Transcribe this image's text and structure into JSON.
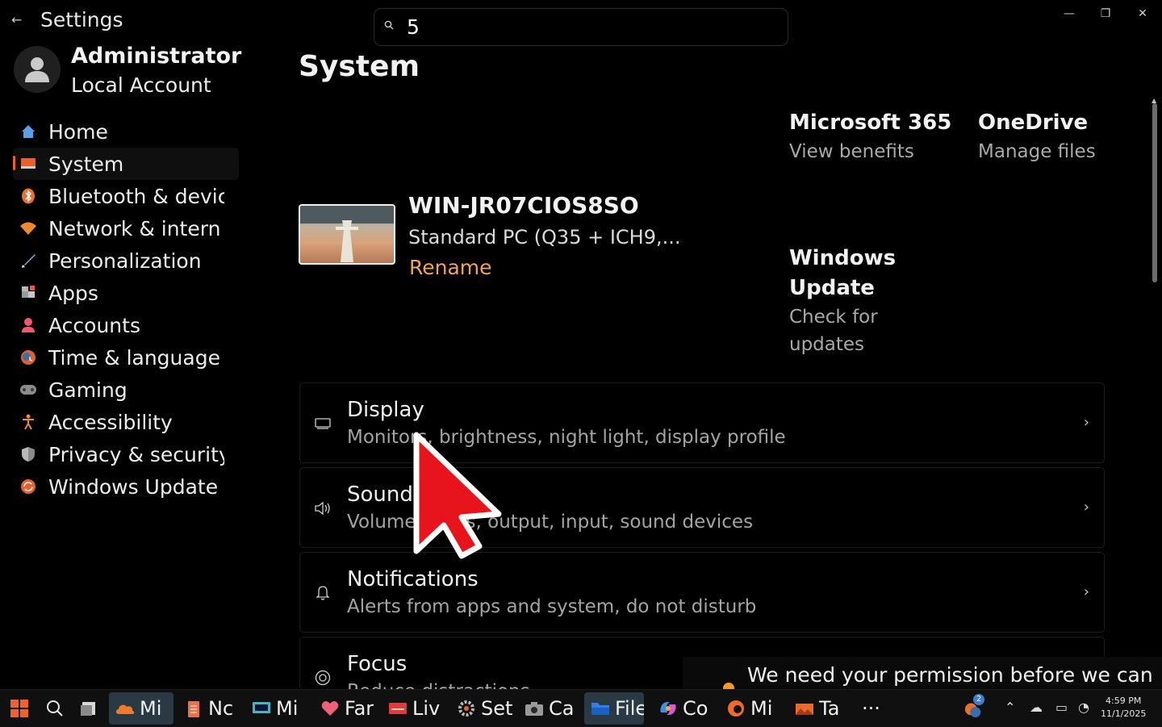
{
  "window": {
    "title": "Settings",
    "back_icon": "back-arrow-icon",
    "minimize_glyph": "—",
    "maximize_glyph": "❐",
    "close_glyph": "✕"
  },
  "search": {
    "value": "5",
    "icon": "search-icon"
  },
  "profile": {
    "name": "Administrator",
    "account_type": "Local Account"
  },
  "sidebar": {
    "items": [
      {
        "label": "Home",
        "icon": "home-icon"
      },
      {
        "label": "System",
        "icon": "system-icon",
        "selected": true
      },
      {
        "label": "Bluetooth & devic",
        "icon": "bluetooth-icon"
      },
      {
        "label": "Network & intern",
        "icon": "network-icon"
      },
      {
        "label": "Personalization",
        "icon": "brush-icon"
      },
      {
        "label": "Apps",
        "icon": "apps-icon"
      },
      {
        "label": "Accounts",
        "icon": "accounts-icon"
      },
      {
        "label": "Time & language",
        "icon": "time-language-icon"
      },
      {
        "label": "Gaming",
        "icon": "gaming-icon"
      },
      {
        "label": "Accessibility",
        "icon": "accessibility-icon"
      },
      {
        "label": "Privacy & security",
        "icon": "shield-icon"
      },
      {
        "label": "Windows Update",
        "icon": "windows-update-icon"
      }
    ]
  },
  "main": {
    "title": "System",
    "device": {
      "name": "WIN-JR07CIOS8SO",
      "model": "Standard PC (Q35 + ICH9,...",
      "rename_label": "Rename"
    },
    "promos": [
      {
        "title": "Microsoft 365",
        "subtitle": "View benefits"
      },
      {
        "title": "OneDrive",
        "subtitle": "Manage files"
      },
      {
        "title_line1": "Windows",
        "title_line2": "Update",
        "subtitle_line1": "Check for",
        "subtitle_line2": "updates"
      }
    ],
    "cards": [
      {
        "title": "Display",
        "subtitle": "Monitors, brightness, night light, display profile",
        "icon": "display-icon"
      },
      {
        "title": "Sound",
        "subtitle": "Volume levels, output, input, sound devices",
        "icon": "speaker-icon"
      },
      {
        "title": "Notifications",
        "subtitle": "Alerts from apps and system, do not disturb",
        "icon": "bell-icon"
      },
      {
        "title": "Focus",
        "subtitle": "Reduce distractions",
        "icon": "focus-icon"
      }
    ]
  },
  "toast": {
    "text": "We need your permission before we can"
  },
  "taskbar": {
    "apps": [
      {
        "label": "Mi",
        "icon": "onedrive-icon",
        "active": true
      },
      {
        "label": "Nc",
        "icon": "notepad-icon"
      },
      {
        "label": "Mi",
        "icon": "media-icon"
      },
      {
        "label": "Far",
        "icon": "heart-icon"
      },
      {
        "label": "Liv",
        "icon": "live-icon"
      },
      {
        "label": "Set",
        "icon": "settings-gear-icon"
      },
      {
        "label": "Ca",
        "icon": "camera-icon"
      },
      {
        "label": "File",
        "icon": "file-explorer-icon",
        "active": true
      },
      {
        "label": "Co",
        "icon": "copilot-icon"
      },
      {
        "label": "Mi",
        "icon": "edge-icon"
      },
      {
        "label": "Ta",
        "icon": "taskbar-app-icon"
      }
    ],
    "overflow_label": "···",
    "badge_count": "2",
    "time": "4:59 PM",
    "date": "11/1/2025"
  }
}
